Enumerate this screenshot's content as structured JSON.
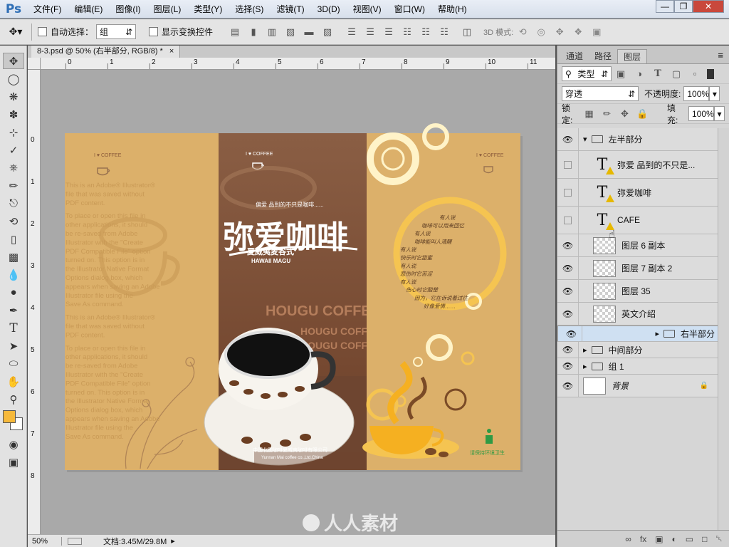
{
  "app": {
    "logo": "Ps"
  },
  "menu": [
    "文件(F)",
    "编辑(E)",
    "图像(I)",
    "图层(L)",
    "类型(Y)",
    "选择(S)",
    "滤镜(T)",
    "3D(D)",
    "视图(V)",
    "窗口(W)",
    "帮助(H)"
  ],
  "options": {
    "auto_select_label": "自动选择：",
    "auto_select_value": "组",
    "show_transform_label": "显示变换控件",
    "mode_3d_label": "3D 模式:"
  },
  "document": {
    "tab_title": "8-3.psd @ 50% (右半部分, RGB/8) *",
    "ruler_h": [
      "0",
      "1",
      "2",
      "3",
      "4",
      "5",
      "6",
      "7",
      "8",
      "9",
      "10",
      "11"
    ],
    "ruler_v": [
      "0",
      "1",
      "2",
      "3",
      "4",
      "5",
      "6",
      "7",
      "8"
    ],
    "zoom": "50%",
    "doc_info": "文档:3.45M/29.8M"
  },
  "artwork": {
    "left": {
      "logo_text": "I ♥ COFFEE",
      "paragraphs": [
        "This is an Adobe® Illustrator® file that was saved without PDF content.",
        "To place or open this file in other applications, it should be re-saved from Adobe Illustrator with the \"Create PDF Compatible File\" option turned on. This option is in the Illustrator Native Format Options dialog box, which appears when saving an Adobe Illustrator file using the Save As command.",
        "This is an Adobe® Illustrator® file that was saved without PDF content.",
        "To place or open this file in other applications, it should be re-saved from Adobe Illustrator with the \"Create PDF Compatible File\" option turned on. This option is in the Illustrator Native Format Options dialog box, which appears when saving an Adobe Illustrator file using the Save As command."
      ]
    },
    "middle": {
      "logo_text": "I ♥ COFFEE",
      "subtitle": "偏爱 品到的不只是咖啡......",
      "title": "弥爱咖啡",
      "brand_cn": "夏威夷麦谷式",
      "brand_en": "HAWAII MAGU",
      "hougu": [
        "HOUGU COFFEE",
        "HOUGU COFFEE",
        "HOUGU COFFEE"
      ],
      "company_cn": "中国北国咖啡夏威夷咖啡有限公司",
      "company_en": "Yunnan Mai coffee co.,Ltd.China"
    },
    "right": {
      "logo_text": "I ♥ COFFEE",
      "poem": [
        "有人说",
        "咖啡可以用来回忆",
        "有人说",
        "咖啡能叫人清醒",
        "有人说",
        "快乐时它甜蜜",
        "有人说",
        "悲伤时它苦涩",
        "有人说",
        "伤心时它酸楚",
        "因为，它在诉说着过往",
        "好像爱情……"
      ],
      "hygiene": "请保持环境卫生"
    }
  },
  "panel": {
    "tabs": [
      "通道",
      "路径",
      "图层"
    ],
    "active_tab": "图层",
    "filter_kind": "类型",
    "blend_mode": "穿透",
    "opacity_label": "不透明度:",
    "opacity_value": "100%",
    "lock_label": "锁定:",
    "fill_label": "填充:",
    "fill_value": "100%",
    "layers": [
      {
        "name": "左半部分",
        "kind": "group-open",
        "visible": true,
        "indent": 0,
        "selected": false
      },
      {
        "name": "弥爱 品到的不只是...",
        "kind": "text",
        "visible": false,
        "indent": 1,
        "selected": false
      },
      {
        "name": "弥爱咖啡",
        "kind": "text",
        "visible": false,
        "indent": 1,
        "selected": false
      },
      {
        "name": "CAFE",
        "kind": "text",
        "visible": false,
        "indent": 1,
        "selected": false
      },
      {
        "name": "图层 6 副本",
        "kind": "pixel",
        "visible": true,
        "indent": 1,
        "selected": false
      },
      {
        "name": "图层 7 副本 2",
        "kind": "pixel",
        "visible": true,
        "indent": 1,
        "selected": false
      },
      {
        "name": "图层 35",
        "kind": "pixel",
        "visible": true,
        "indent": 1,
        "selected": false
      },
      {
        "name": "英文介绍",
        "kind": "pixel",
        "visible": true,
        "indent": 1,
        "selected": false
      },
      {
        "name": "右半部分",
        "kind": "group",
        "visible": true,
        "indent": 0,
        "selected": true
      },
      {
        "name": "中间部分",
        "kind": "group",
        "visible": true,
        "indent": 0,
        "selected": false
      },
      {
        "name": "组 1",
        "kind": "group",
        "visible": true,
        "indent": 0,
        "selected": false
      },
      {
        "name": "背景",
        "kind": "background",
        "visible": true,
        "indent": 0,
        "selected": false
      }
    ],
    "bottom_icons": [
      "link-icon",
      "fx-icon",
      "mask-icon",
      "adjustment-icon",
      "folder-icon",
      "new-layer-icon",
      "trash-icon"
    ]
  },
  "watermark": "人人素材",
  "colors": {
    "foreground": "#f6b93b",
    "background": "#ffffff",
    "canvas_tan": "#dcb06a",
    "middle_brown": "#9b6a4a"
  }
}
